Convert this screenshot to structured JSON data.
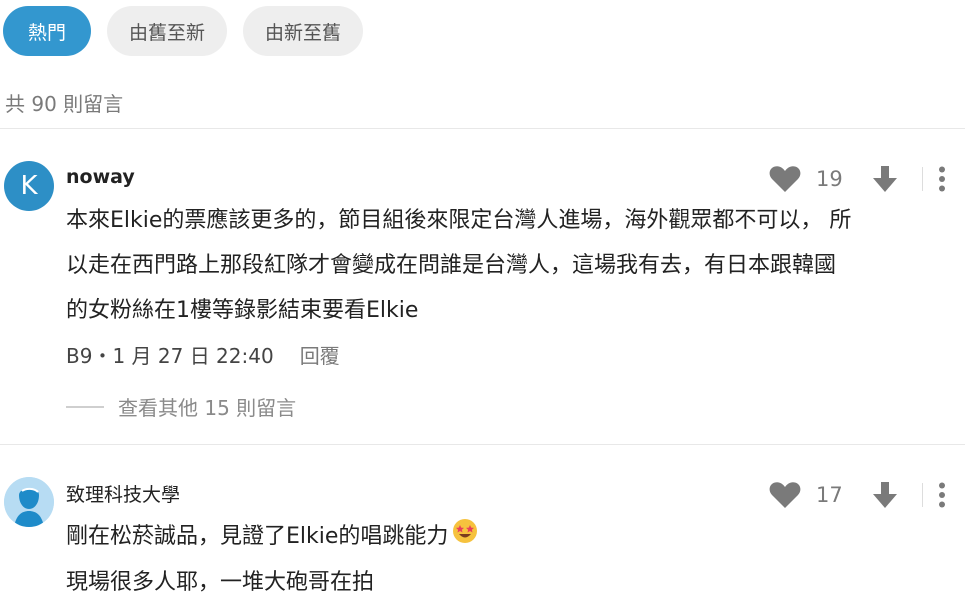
{
  "tabs": [
    {
      "label": "熱門",
      "active": true
    },
    {
      "label": "由舊至新",
      "active": false
    },
    {
      "label": "由新至舊",
      "active": false
    }
  ],
  "comment_count": "共 90 則留言",
  "comments": [
    {
      "avatar_letter": "K",
      "avatar_color": "#2d8fc6",
      "username": "noway",
      "likes": "19",
      "lines": [
        "本來Elkie的票應該更多的，節目組後來限定台灣人進場，海外觀眾都不可以， 所",
        "以走在西門路上那段紅隊才會變成在問誰是台灣人，這場我有去，有日本跟韓國",
        "的女粉絲在1樓等錄影結束要看Elkie"
      ],
      "meta": "B9・1 月 27 日 22:40",
      "reply_label": "回覆",
      "more_replies": "查看其他 15 則留言"
    },
    {
      "avatar_icon": "person-icon",
      "username": "致理科技大學",
      "likes": "17",
      "lines": [
        "剛在松菸誠品，見證了Elkie的唱跳能力",
        "現場很多人耶，一堆大砲哥在拍"
      ]
    }
  ],
  "colors": {
    "accent": "#3397cf",
    "icon_gray": "#7a7a7a"
  }
}
